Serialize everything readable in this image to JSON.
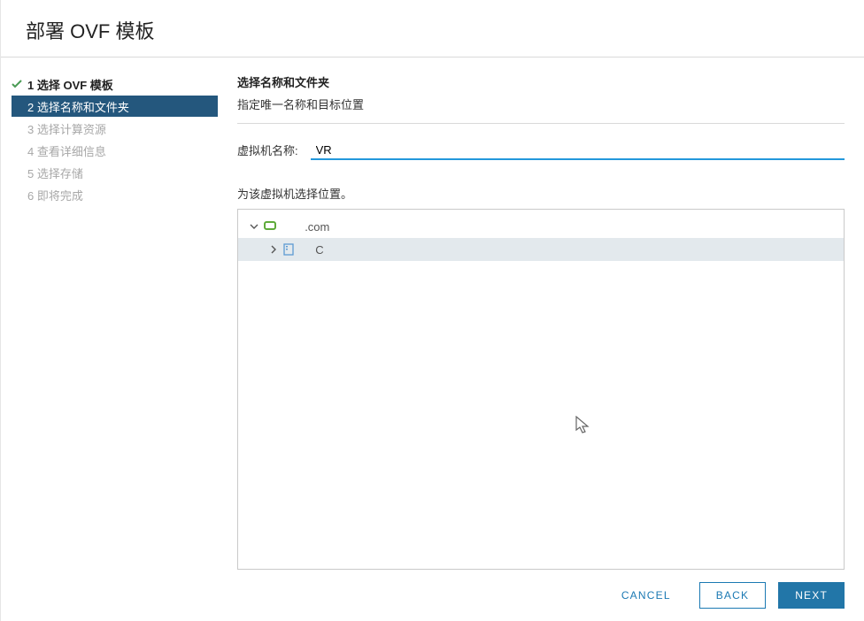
{
  "title_prefix": "部署 ",
  "title_thin": "OVF ",
  "title_suffix": "模板",
  "steps": [
    {
      "label": "1 选择 OVF 模板"
    },
    {
      "label": "2 选择名称和文件夹"
    },
    {
      "label": "3 选择计算资源"
    },
    {
      "label": "4 查看详细信息"
    },
    {
      "label": "5 选择存储"
    },
    {
      "label": "6 即将完成"
    }
  ],
  "panel": {
    "heading": "选择名称和文件夹",
    "sub": "指定唯一名称和目标位置",
    "vm_name_label": "虚拟机名称:",
    "vm_name_value": "VR",
    "location_label": "为该虚拟机选择位置。"
  },
  "tree": {
    "root_text": ".com",
    "child_text": "C"
  },
  "buttons": {
    "cancel": "CANCEL",
    "back": "BACK",
    "next": "NEXT"
  }
}
